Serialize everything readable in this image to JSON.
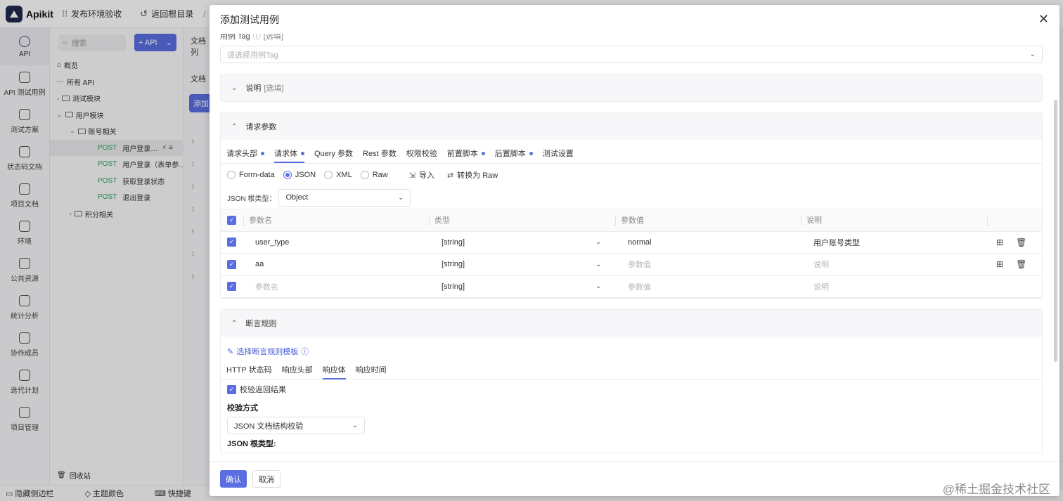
{
  "app": {
    "brand": "Apikit",
    "top_actions": [
      "发布环境验收",
      "返回根目录",
      "/"
    ]
  },
  "leftnav": [
    {
      "label": "API",
      "icon": "api-icon",
      "active": true
    },
    {
      "label": "API 测试用例",
      "icon": "testcase-icon"
    },
    {
      "label": "测试方案",
      "icon": "plan-icon"
    },
    {
      "label": "状态码文档",
      "icon": "statuscode-icon"
    },
    {
      "label": "项目文档",
      "icon": "doc-icon"
    },
    {
      "label": "环境",
      "icon": "env-icon"
    },
    {
      "label": "公共资源",
      "icon": "puzzle-icon"
    },
    {
      "label": "统计分析",
      "icon": "chart-icon"
    },
    {
      "label": "协作成员",
      "icon": "users-icon"
    },
    {
      "label": "迭代计划",
      "icon": "calendar-icon"
    },
    {
      "label": "项目管理",
      "icon": "gear-icon"
    }
  ],
  "tree": {
    "search_placeholder": "搜索",
    "add_api": "+ API",
    "items": [
      {
        "label": "概览",
        "indent": 0,
        "kind": "home"
      },
      {
        "label": "所有 API",
        "indent": 0,
        "kind": "all"
      },
      {
        "label": "测试模块",
        "indent": 0,
        "kind": "folder",
        "chev": "›"
      },
      {
        "label": "用户模块",
        "indent": 0,
        "kind": "folder",
        "chev": "⌄"
      },
      {
        "label": "账号相关",
        "indent": 1,
        "kind": "folder",
        "chev": "⌄"
      },
      {
        "label": "用户登录…",
        "indent": 2,
        "kind": "api",
        "method": "POST",
        "selected": true
      },
      {
        "label": "用户登录（表单参…",
        "indent": 2,
        "kind": "api",
        "method": "POST"
      },
      {
        "label": "获取登录状态",
        "indent": 2,
        "kind": "api",
        "method": "POST"
      },
      {
        "label": "退出登录",
        "indent": 2,
        "kind": "api",
        "method": "POST"
      },
      {
        "label": "积分相关",
        "indent": 1,
        "kind": "folder",
        "chev": "›"
      }
    ],
    "recycle": "回收站"
  },
  "mid": {
    "tab1": "文档列",
    "tab2": "文档",
    "btn": "添加"
  },
  "statusbar": [
    "隐藏侧边栏",
    "主题颜色",
    "快捷键"
  ],
  "watermark": "@稀土掘金技术社区",
  "modal": {
    "title": "添加测试用例",
    "tag_label": "用例 Tag",
    "tag_optional": "[选填]",
    "tag_placeholder": "请选择用例Tag",
    "desc_section": {
      "title": "说明",
      "optional": "[选填]"
    },
    "request_section": {
      "title": "请求参数",
      "tabs": [
        {
          "label": "请求头部",
          "dot": true
        },
        {
          "label": "请求体",
          "dot": true,
          "active": true
        },
        {
          "label": "Query 参数",
          "dot": false
        },
        {
          "label": "Rest 参数",
          "dot": false
        },
        {
          "label": "权限校验",
          "dot": false
        },
        {
          "label": "前置脚本",
          "dot": true
        },
        {
          "label": "后置脚本",
          "dot": true
        },
        {
          "label": "测试设置",
          "dot": false
        }
      ],
      "body_types": [
        "Form-data",
        "JSON",
        "XML",
        "Raw"
      ],
      "body_type_selected": "JSON",
      "import_label": "导入",
      "convert_label": "转换为 Raw",
      "root_type_label": "JSON 根类型：",
      "root_type_value": "Object",
      "columns": [
        "参数名",
        "类型",
        "参数值",
        "说明"
      ],
      "rows": [
        {
          "name": "user_type",
          "type": "[string]",
          "value": "normal",
          "desc": "用户账号类型",
          "placeholder": false
        },
        {
          "name": "aa",
          "type": "[string]",
          "value": "参数值",
          "desc": "说明",
          "placeholder": true
        },
        {
          "name": "参数名",
          "type": "[string]",
          "value": "参数值",
          "desc": "说明",
          "placeholder": true,
          "empty": true
        }
      ]
    },
    "assert_section": {
      "title": "断言规则",
      "template_link": "选择断言规则模板",
      "tabs": [
        {
          "label": "HTTP 状态码"
        },
        {
          "label": "响应头部"
        },
        {
          "label": "响应体",
          "active": true
        },
        {
          "label": "响应时间"
        }
      ],
      "verify_label": "校验返回结果",
      "method_label": "校验方式",
      "method_value": "JSON 文档结构校验",
      "root_label": "JSON 根类型:"
    },
    "confirm": "确认",
    "cancel": "取消"
  },
  "colors": {
    "accent": "#5b6ee1",
    "post": "#2aa55b"
  }
}
